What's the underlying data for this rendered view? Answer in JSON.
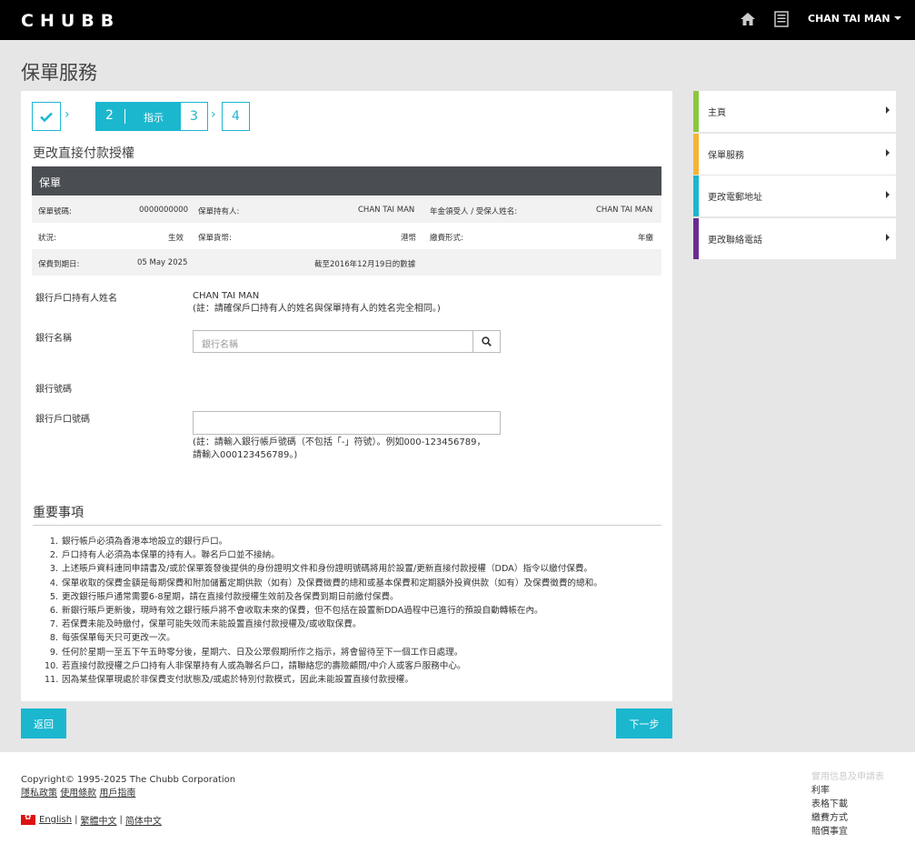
{
  "header": {
    "brand": "CHUBB",
    "user_name": "CHAN TAI MAN"
  },
  "page": {
    "title": "保單服務"
  },
  "stepper": {
    "step1_icon": "check-icon",
    "step2_number": "2",
    "step2_label": "指示",
    "step3_number": "3",
    "step4_number": "4"
  },
  "form": {
    "section_title": "更改直接付款授權",
    "policy_header": "保單",
    "policy_rows": {
      "policy_no_label": "保單號碼:",
      "policy_no_value": "0000000000",
      "holder_label": "保單持有人:",
      "holder_value": "CHAN TAI MAN",
      "annuitant_label": "年金領受人 / 受保人姓名:",
      "annuitant_value": "CHAN TAI MAN",
      "status_label": "狀況:",
      "status_value": "生效",
      "currency_label": "保單貨幣:",
      "currency_value": "港幣",
      "payment_mode_label": "繳費形式:",
      "payment_mode_value": "年繳",
      "expiry_label": "保費到期日:",
      "expiry_value": "05 May 2025",
      "data_note": "截至2016年12月19日的數據"
    },
    "account_holder_label": "銀行戶口持有人姓名",
    "account_holder_value": "CHAN TAI MAN",
    "account_holder_note": "(註：請確保戶口持有人的姓名與保單持有人的姓名完全相同。)",
    "bank_name_label": "銀行名稱",
    "bank_name_placeholder": "銀行名稱",
    "bank_code_label": "銀行號碼",
    "account_no_label": "銀行戶口號碼",
    "account_no_value": "",
    "account_no_note_1": "(註：請輸入銀行帳戶號碼（不包括「-」符號）。例如000-123456789，",
    "account_no_note_2": "請輸入000123456789。)"
  },
  "notes": {
    "title": "重要事項",
    "items": [
      "銀行帳戶必須為香港本地設立的銀行戶口。",
      "戶口持有人必須為本保單的持有人。聯名戶口並不接納。",
      "上述賬戶資料連同申請書及/或於保單簽發後提供的身份證明文件和身份證明號碼將用於設置/更新直接付款授權（DDA）指令以繳付保費。",
      "保單收取的保費金額是每期保費和附加儲蓄定期供款（如有）及保費徵費的總和或基本保費和定期額外投資供款（如有）及保費徵費的總和。",
      "更改銀行賬戶通常需要6-8星期，請在直接付款授權生效前及各保費到期日前繳付保費。",
      "新銀行賬戶更新後，現時有效之銀行賬戶將不會收取未來的保費，但不包括在設置新DDA過程中已進行的預設自動轉帳在內。",
      "若保費未能及時繳付，保單可能失效而未能設置直接付款授權及/或收取保費。",
      "每張保單每天只可更改一次。",
      "任何於星期一至五下午五時零分後，星期六、日及公眾假期所作之指示，將會留待至下一個工作日處理。",
      "若直接付款授權之戶口持有人非保單持有人或為聯名戶口，請聯絡您的壽險顧問/中介人或客戶服務中心。",
      "因為某些保單現處於非保費支付狀態及/或處於特別付款模式，因此未能設置直接付款授權。"
    ],
    "numbers": [
      "1.",
      "2.",
      "3.",
      "4.",
      "5.",
      "6.",
      "7.",
      "8.",
      "9.",
      "10.",
      "11."
    ]
  },
  "buttons": {
    "back": "返回",
    "next": "下一步"
  },
  "sidebar": {
    "items": [
      {
        "label": "主頁",
        "color": "#8dc63f"
      },
      {
        "label": "保單服務",
        "color": "#f7b334"
      },
      {
        "label": "更改電郵地址",
        "color": "#1bb7cf"
      },
      {
        "label": "更改聯絡電話",
        "color": "#6a2c91"
      }
    ]
  },
  "footer": {
    "copyright": "Copyright© 1995-2025 The Chubb Corporation",
    "privacy": "隱私政策",
    "terms": "使用條款",
    "guide": "用戶指南",
    "lang_en": "English",
    "lang_tc": "繁體中文",
    "lang_sc": "简体中文",
    "sep": "|",
    "right_header": "實用信息及申請表",
    "right_links": [
      "利率",
      "表格下載",
      "繳費方式",
      "賠償事宜"
    ]
  },
  "colors": {
    "accent": "#1bb7cf",
    "policy_header_bg": "#4a4d52"
  }
}
